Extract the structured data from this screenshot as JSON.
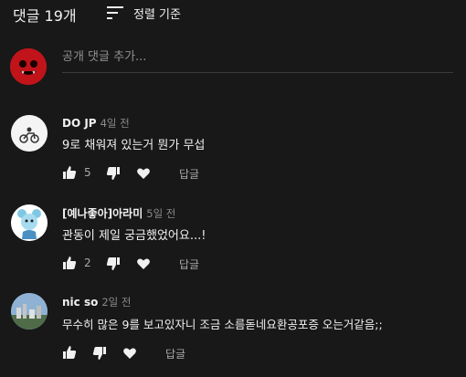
{
  "header": {
    "comment_count": "댓글 19개",
    "sort_label": "정렬 기준"
  },
  "add_comment": {
    "placeholder": "공개 댓글 추가..."
  },
  "comments": [
    {
      "author": "DO JP",
      "time": "4일 전",
      "text": "9로 채워져 있는거 뭔가 무섭",
      "likes": "5",
      "reply": "답글"
    },
    {
      "author": "[예나좋아]아라미",
      "time": "5일 전",
      "text": "관동이 제일 궁금했었어요...!",
      "likes": "2",
      "reply": "답글"
    },
    {
      "author": "nic so",
      "time": "2일 전",
      "text": "무수히 많은 9를 보고있자니 조금 소름돋네요환공포증 오는거같음;;",
      "likes": "",
      "reply": "답글"
    }
  ],
  "colors": {
    "background": "#181818",
    "text": "#f1f1f1",
    "secondary": "#aaaaaa",
    "user_avatar": "#c0141a"
  }
}
